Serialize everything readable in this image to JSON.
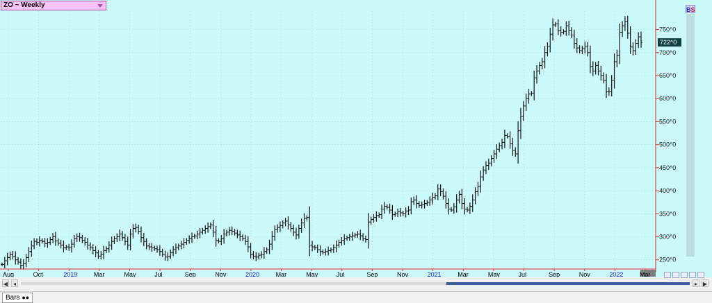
{
  "symbol": {
    "label": "ZO ~ Weekly"
  },
  "badge": {
    "b": "B",
    "s": "S"
  },
  "last_price_label": "722^0",
  "tab": {
    "label": "Bars"
  },
  "chart_data": {
    "type": "ohlc",
    "title": "ZO ~ Weekly",
    "xlabel": "",
    "ylabel": "",
    "ylim": [
      230,
      790
    ],
    "y_ticks": [
      250,
      300,
      350,
      400,
      450,
      500,
      550,
      600,
      650,
      700,
      750
    ],
    "y_tick_labels": [
      "250^0",
      "300^0",
      "350^0",
      "400^0",
      "450^0",
      "500^0",
      "550^0",
      "600^0",
      "650^0",
      "700^0",
      "750^0"
    ],
    "x_tick_labels": [
      {
        "label": "Aug",
        "color": "#000000"
      },
      {
        "label": "Oct",
        "color": "#000000"
      },
      {
        "label": "2019",
        "color": "#1a1ad8"
      },
      {
        "label": "Mar",
        "color": "#000000"
      },
      {
        "label": "May",
        "color": "#000000"
      },
      {
        "label": "Jul",
        "color": "#000000"
      },
      {
        "label": "Sep",
        "color": "#000000"
      },
      {
        "label": "Nov",
        "color": "#000000"
      },
      {
        "label": "2020",
        "color": "#1a1ad8"
      },
      {
        "label": "Mar",
        "color": "#000000"
      },
      {
        "label": "May",
        "color": "#000000"
      },
      {
        "label": "Jul",
        "color": "#000000"
      },
      {
        "label": "Sep",
        "color": "#000000"
      },
      {
        "label": "Nov",
        "color": "#000000"
      },
      {
        "label": "2021",
        "color": "#1a1ad8"
      },
      {
        "label": "Mar",
        "color": "#000000"
      },
      {
        "label": "May",
        "color": "#000000"
      },
      {
        "label": "Jul",
        "color": "#000000"
      },
      {
        "label": "Sep",
        "color": "#000000"
      },
      {
        "label": "Nov",
        "color": "#000000"
      },
      {
        "label": "2022",
        "color": "#1a1ad8"
      },
      {
        "label": "Mar",
        "color": "#000000"
      }
    ],
    "last_price": 722,
    "grid": true,
    "background": "#cbfaf9",
    "bar_color": "#111111",
    "axis_line_color": "#e03030",
    "series": [
      {
        "close": [
          240,
          248,
          255,
          262,
          258,
          250,
          245,
          238,
          242,
          255,
          268,
          280,
          290,
          288,
          292,
          290,
          285,
          288,
          294,
          300,
          291,
          286,
          282,
          276,
          278,
          276,
          284,
          296,
          300,
          298,
          292,
          288,
          282,
          276,
          270,
          265,
          258,
          262,
          270,
          274,
          282,
          290,
          296,
          300,
          306,
          298,
          290,
          282,
          306,
          318,
          320,
          312,
          298,
          290,
          280,
          278,
          276,
          274,
          272,
          268,
          262,
          256,
          258,
          266,
          272,
          276,
          280,
          284,
          288,
          292,
          296,
          300,
          302,
          306,
          310,
          314,
          318,
          322,
          326,
          310,
          292,
          290,
          296,
          306,
          310,
          314,
          312,
          308,
          304,
          300,
          296,
          290,
          278,
          262,
          258,
          256,
          260,
          262,
          268,
          272,
          284,
          300,
          316,
          320,
          324,
          330,
          334,
          326,
          318,
          310,
          304,
          318,
          330,
          340,
          342,
          282,
          278,
          276,
          272,
          268,
          266,
          268,
          270,
          272,
          276,
          282,
          288,
          292,
          296,
          298,
          300,
          302,
          304,
          306,
          302,
          296,
          294,
          332,
          338,
          342,
          346,
          348,
          360,
          366,
          364,
          358,
          348,
          350,
          354,
          352,
          350,
          356,
          358,
          376,
          380,
          372,
          368,
          370,
          372,
          375,
          380,
          386,
          390,
          404,
          398,
          388,
          372,
          360,
          358,
          365,
          380,
          392,
          372,
          360,
          358,
          366,
          380,
          398,
          410,
          430,
          445,
          455,
          460,
          470,
          480,
          490,
          498,
          505,
          520,
          518,
          502,
          488,
          480,
          530,
          562,
          584,
          600,
          610,
          612,
          645,
          660,
          672,
          680,
          700,
          714,
          740,
          760,
          762,
          748,
          744,
          746,
          758,
          748,
          738,
          720,
          710,
          704,
          708,
          714,
          700,
          670,
          660,
          672,
          660,
          650,
          640,
          615,
          616,
          640,
          680,
          694,
          744,
          758,
          768,
          742,
          712,
          704,
          720,
          734,
          722
        ]
      }
    ]
  }
}
